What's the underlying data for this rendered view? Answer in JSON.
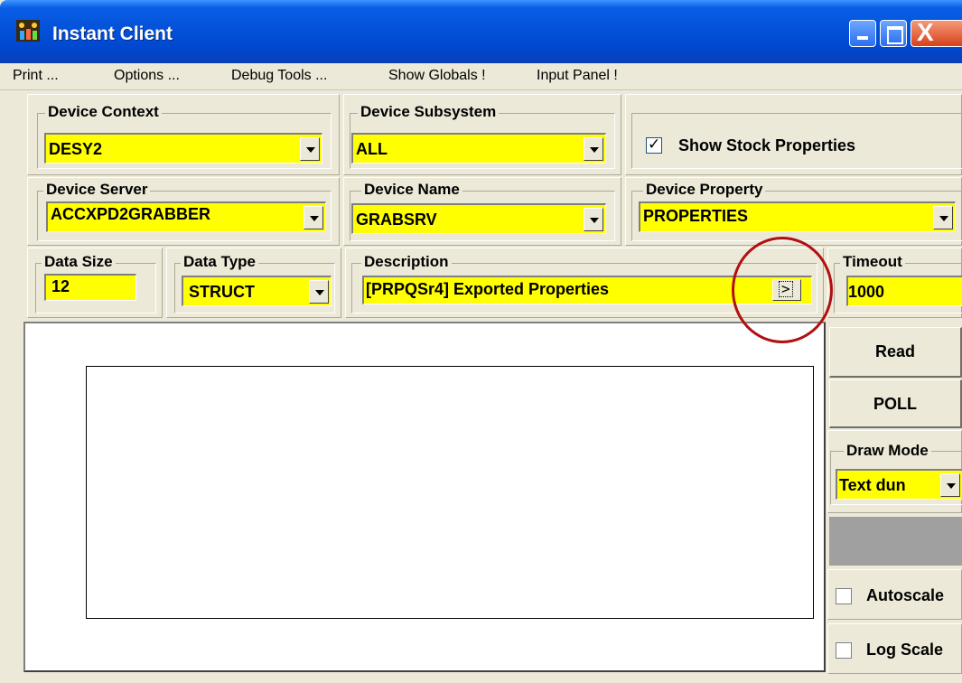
{
  "window": {
    "title": "Instant Client",
    "close_glyph": "X"
  },
  "menu": {
    "items": [
      "Print ...",
      "Options ...",
      "Debug Tools ...",
      "Show Globals !",
      "Input Panel !"
    ]
  },
  "device_context": {
    "label": "Device Context",
    "value": "DESY2"
  },
  "device_subsystem": {
    "label": "Device Subsystem",
    "value": "ALL"
  },
  "show_stock": {
    "label": "Show Stock Properties",
    "checked": true
  },
  "device_server": {
    "label": "Device Server",
    "value": "ACCXPD2GRABBER"
  },
  "device_name": {
    "label": "Device Name",
    "value": "GRABSRV"
  },
  "device_property": {
    "label": "Device Property",
    "value": "PROPERTIES"
  },
  "data_size": {
    "label": "Data Size",
    "value": "12"
  },
  "data_type": {
    "label": "Data Type",
    "value": "STRUCT"
  },
  "description": {
    "label": "Description",
    "value": "[PRPQSr4] Exported Properties",
    "button_glyph": ">"
  },
  "timeout": {
    "label": "Timeout",
    "value": "1000"
  },
  "buttons": {
    "read": "Read",
    "poll": "POLL"
  },
  "draw_mode": {
    "label": "Draw Mode",
    "value": "Text dun"
  },
  "autoscale": {
    "label": "Autoscale",
    "checked": false
  },
  "log_scale": {
    "label": "Log Scale",
    "checked": false
  },
  "colors": {
    "highlight": "#ffff00",
    "annotation_circle": "#b01010",
    "titlebar": "#0352d9"
  },
  "icons": [
    "app-icon",
    "minimize-icon",
    "maximize-icon",
    "close-icon",
    "chevron-down-icon",
    "expand-description-icon",
    "checkbox-icon"
  ]
}
